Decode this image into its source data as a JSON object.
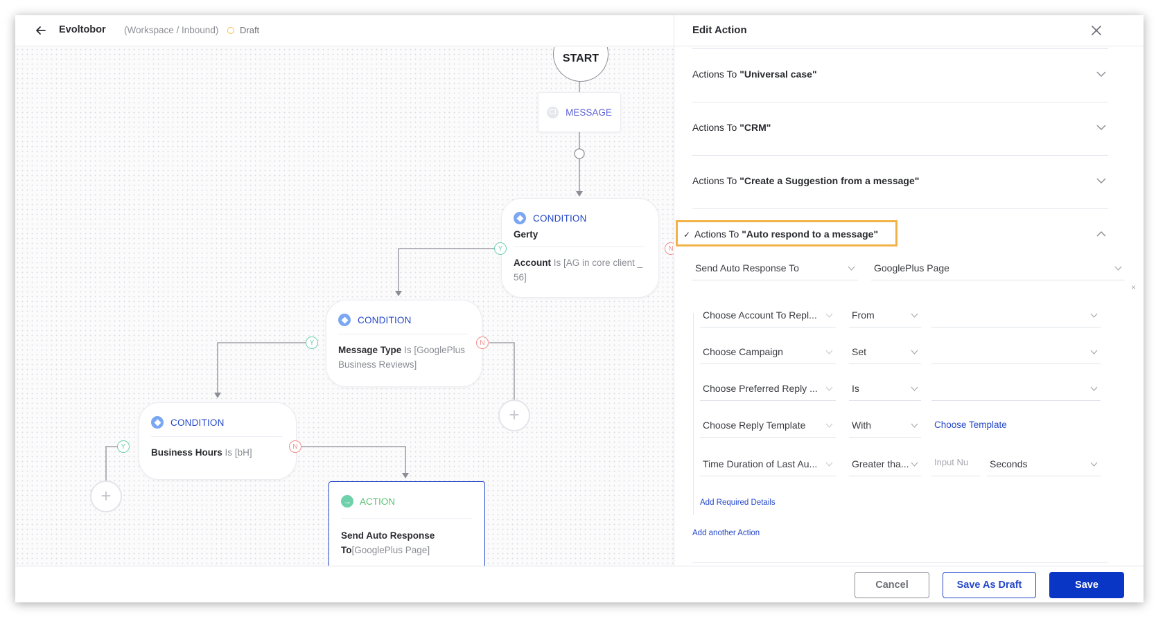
{
  "header": {
    "back_icon": "arrow-left-icon",
    "title": "Evoltobor",
    "breadcrumb": "(Workspace / Inbound)",
    "status_icon": "draft-circle-icon",
    "status": "Draft",
    "status_color": "#f2c14e"
  },
  "canvas": {
    "start": {
      "label": "START"
    },
    "message": {
      "icon": "message-bubble-icon",
      "label": "MESSAGE"
    },
    "conditions": [
      {
        "type_label": "CONDITION",
        "name": "Gerty",
        "field": "Account",
        "operator": "Is",
        "value": "[AG in core client _ 56]",
        "yes": "Y",
        "no": "N"
      },
      {
        "type_label": "CONDITION",
        "name": "",
        "field": "Message Type",
        "operator": "Is",
        "value": "[GooglePlus Business Reviews]",
        "yes": "Y",
        "no": "N"
      },
      {
        "type_label": "CONDITION",
        "name": "",
        "field": "Business Hours",
        "operator": "Is",
        "value": "[bH]",
        "yes": "Y",
        "no": "N"
      }
    ],
    "action": {
      "type_label": "ACTION",
      "title": "Send Auto Response",
      "prefix": "To",
      "value": "[GooglePlus Page]"
    },
    "add_node_label": "+"
  },
  "panel": {
    "title": "Edit Action",
    "close_icon": "close-icon",
    "accordion": [
      {
        "prefix": "Actions To ",
        "name": "\"Universal case\"",
        "expanded": false
      },
      {
        "prefix": "Actions To ",
        "name": "\"CRM\"",
        "expanded": false
      },
      {
        "prefix": "Actions To ",
        "name": "\"Create a Suggestion from a message\"",
        "expanded": false
      },
      {
        "prefix": "Actions To ",
        "name": "\"Auto respond to a message\"",
        "expanded": true,
        "check": "✓"
      }
    ],
    "send_to": {
      "field": "Send Auto Response To",
      "value": "GooglePlus Page",
      "remove": "×"
    },
    "rows": [
      {
        "field": "Choose Account To Repl...",
        "operator": "From",
        "value": ""
      },
      {
        "field": "Choose Campaign",
        "operator": "Set",
        "value": ""
      },
      {
        "field": "Choose Preferred Reply ...",
        "operator": "Is",
        "value": ""
      },
      {
        "field": "Choose Reply Template",
        "operator": "With",
        "link": "Choose Template"
      },
      {
        "field": "Time Duration of Last Au...",
        "operator": "Greater tha...",
        "input_placeholder": "Input Nu",
        "unit": "Seconds"
      }
    ],
    "add_required": "Add Required Details",
    "add_action": "Add another Action",
    "highlight_color": "#f2b247"
  },
  "footer": {
    "cancel": "Cancel",
    "save_draft": "Save As Draft",
    "save": "Save",
    "primary_color": "#0a36c6"
  }
}
